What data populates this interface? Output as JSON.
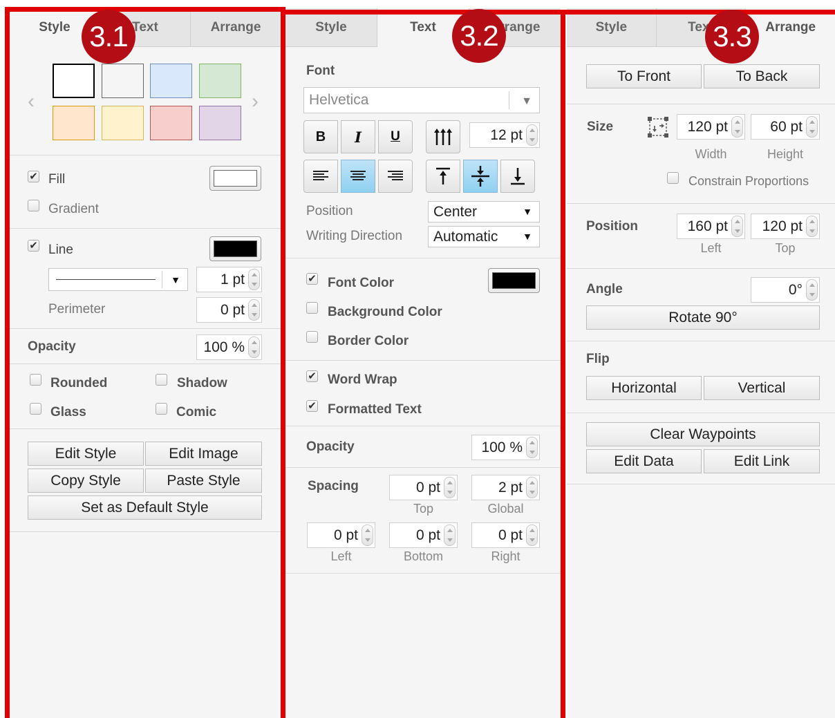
{
  "badges": {
    "p1": "3.1",
    "p2": "3.2",
    "p3": "3.3"
  },
  "tabs": {
    "style": "Style",
    "text": "Text",
    "arrange": "Arrange"
  },
  "style_panel": {
    "palette": [
      "#ffffff",
      "#f5f5f5",
      "#dae8fc",
      "#d5e8d4",
      "#ffe6cc",
      "#fff2cc",
      "#f8cecc",
      "#e1d5e7"
    ],
    "palette_borders": [
      "#000000",
      "#666666",
      "#6c8ebf",
      "#82b366",
      "#d79b00",
      "#d6b656",
      "#b85450",
      "#9673a6"
    ],
    "fill": {
      "label": "Fill",
      "checked": true,
      "color": "#ffffff"
    },
    "gradient": {
      "label": "Gradient",
      "checked": false
    },
    "line": {
      "label": "Line",
      "checked": true,
      "color": "#000000",
      "width": "1 pt"
    },
    "perimeter": {
      "label": "Perimeter",
      "value": "0 pt"
    },
    "opacity": {
      "label": "Opacity",
      "value": "100 %"
    },
    "options": {
      "rounded": "Rounded",
      "shadow": "Shadow",
      "glass": "Glass",
      "comic": "Comic"
    },
    "buttons": {
      "edit_style": "Edit Style",
      "edit_image": "Edit Image",
      "copy_style": "Copy Style",
      "paste_style": "Paste Style",
      "set_default": "Set as Default Style"
    }
  },
  "text_panel": {
    "font_label": "Font",
    "font_value": "Helvetica",
    "font_size": "12 pt",
    "format_glyphs": {
      "bold": "B",
      "italic": "I",
      "underline": "U"
    },
    "position_label": "Position",
    "position_value": "Center",
    "writing_direction_label": "Writing Direction",
    "writing_direction_value": "Automatic",
    "font_color": {
      "label": "Font Color",
      "checked": true,
      "color": "#000000"
    },
    "background_color": {
      "label": "Background Color",
      "checked": false
    },
    "border_color": {
      "label": "Border Color",
      "checked": false
    },
    "word_wrap": {
      "label": "Word Wrap",
      "checked": true
    },
    "formatted_text": {
      "label": "Formatted Text",
      "checked": true
    },
    "opacity": {
      "label": "Opacity",
      "value": "100 %"
    },
    "spacing": {
      "label": "Spacing",
      "top": {
        "value": "0 pt",
        "caption": "Top"
      },
      "global": {
        "value": "2 pt",
        "caption": "Global"
      },
      "left": {
        "value": "0 pt",
        "caption": "Left"
      },
      "bottom": {
        "value": "0 pt",
        "caption": "Bottom"
      },
      "right": {
        "value": "0 pt",
        "caption": "Right"
      }
    }
  },
  "arrange_panel": {
    "to_front": "To Front",
    "to_back": "To Back",
    "size_label": "Size",
    "width": {
      "value": "120 pt",
      "caption": "Width"
    },
    "height": {
      "value": "60 pt",
      "caption": "Height"
    },
    "constrain": {
      "label": "Constrain Proportions",
      "checked": false
    },
    "position_label": "Position",
    "left": {
      "value": "160 pt",
      "caption": "Left"
    },
    "top": {
      "value": "120 pt",
      "caption": "Top"
    },
    "angle_label": "Angle",
    "angle_value": "0°",
    "rotate": "Rotate 90°",
    "flip_label": "Flip",
    "horizontal": "Horizontal",
    "vertical": "Vertical",
    "clear_waypoints": "Clear Waypoints",
    "edit_data": "Edit Data",
    "edit_link": "Edit Link"
  },
  "colors": {
    "frame": "#e00000",
    "badge": "#b50d15",
    "selected_button": "#9fd6f4"
  }
}
